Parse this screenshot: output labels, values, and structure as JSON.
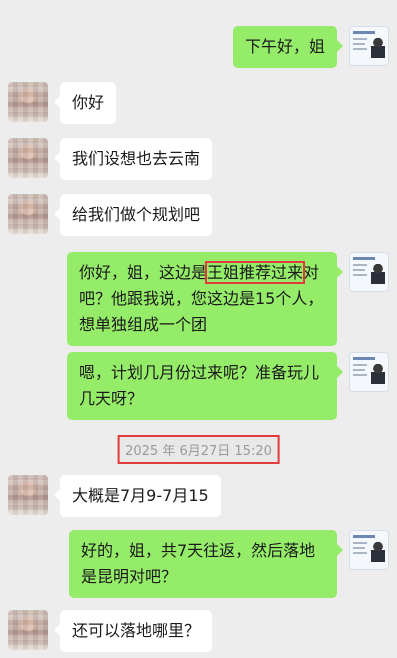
{
  "messages": [
    {
      "side": "out",
      "text": "下午好，姐"
    },
    {
      "side": "in",
      "text": "你好"
    },
    {
      "side": "in",
      "text": "我们设想也去云南"
    },
    {
      "side": "in",
      "text": "给我们做个规划吧"
    },
    {
      "side": "out",
      "parts": [
        "你好，姐，这边是",
        "王姐推荐过来",
        "对吧？他跟我说，您这边是15个人，想单独组成一个团"
      ]
    },
    {
      "side": "out",
      "text": "嗯，计划几月份过来呢？准备玩儿几天呀？"
    },
    {
      "side": "in",
      "text": "大概是7月9-7月15"
    },
    {
      "side": "out",
      "text": "好的，姐，共7天往返，然后落地是昆明对吧？"
    },
    {
      "side": "in",
      "text": "还可以落地哪里？"
    }
  ],
  "timestamp": "2025 年 6月27日 15:20",
  "colors": {
    "sent_bubble": "#95ec69",
    "received_bubble": "#ffffff",
    "background": "#ededed",
    "highlight": "#e23b3b"
  }
}
